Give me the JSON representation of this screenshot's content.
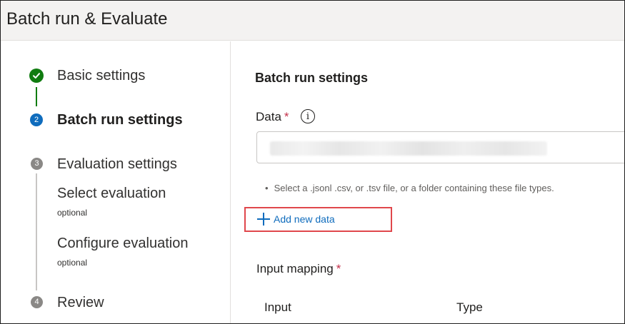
{
  "header": {
    "title": "Batch run & Evaluate"
  },
  "steps": [
    {
      "number": "",
      "label": "Basic settings",
      "state": "completed"
    },
    {
      "number": "2",
      "label": "Batch run settings",
      "state": "active"
    },
    {
      "number": "3",
      "label": "Evaluation settings",
      "state": "pending",
      "substeps": [
        {
          "label": "Select evaluation",
          "sub": "optional"
        },
        {
          "label": "Configure evaluation",
          "sub": "optional"
        }
      ]
    },
    {
      "number": "4",
      "label": "Review",
      "state": "pending"
    }
  ],
  "main": {
    "section_title": "Batch run settings",
    "data_field": {
      "label": "Data",
      "required_mark": "*",
      "info_icon": "i",
      "hint": "Select a .jsonl .csv, or .tsv file, or a folder containing these file types.",
      "hint_bullet": "•",
      "add_button_label": "Add new data"
    },
    "input_mapping": {
      "label": "Input mapping",
      "required_mark": "*",
      "columns": [
        "Input",
        "Type"
      ]
    }
  },
  "colors": {
    "completed": "#107c10",
    "active": "#0f6cbd",
    "pending": "#8a8886",
    "required": "#c4314b",
    "highlight": "#e0474c",
    "link": "#0f6cbd"
  },
  "icons": {
    "completed_step": "checkmark-icon",
    "info": "info-icon",
    "add": "plus-icon"
  }
}
